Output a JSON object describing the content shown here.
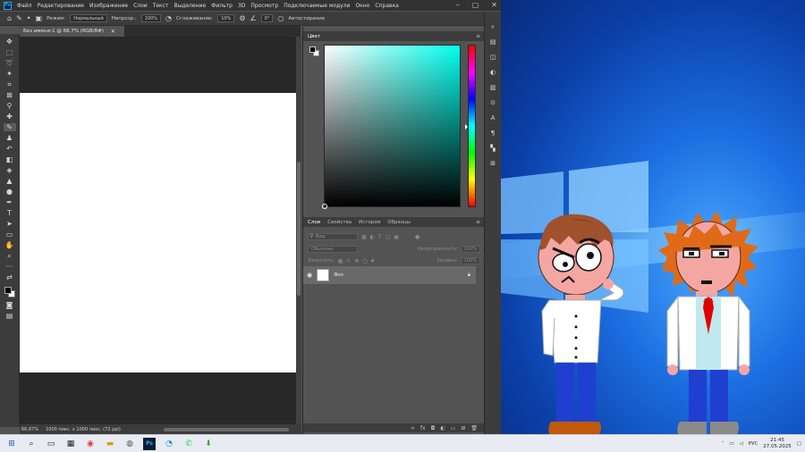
{
  "menubar": {
    "logo": "Ps",
    "items": [
      "Файл",
      "Редактирование",
      "Изображение",
      "Слои",
      "Текст",
      "Выделение",
      "Фильтр",
      "3D",
      "Просмотр",
      "Подключаемые модули",
      "Окно",
      "Справка"
    ]
  },
  "options": {
    "mode_label": "Режим:",
    "mode_value": "Нормальный",
    "opacity_label": "Непрозр.:",
    "opacity_value": "100%",
    "smoothing_label": "Сглаживание:",
    "smoothing_value": "10%",
    "angle_value": "0°",
    "autoerase_label": "Автостирание"
  },
  "document": {
    "tab_title": "Без имени-1 @ 66,7% (RGB/8#)",
    "zoom": "66,67%",
    "info": "1000 пикс. x 1000 пикс. (72 ppi)"
  },
  "color_panel": {
    "title": "Цвет",
    "foreground": "#000000",
    "background": "#ffffff",
    "hue_color": "#00ffee"
  },
  "layers_panel": {
    "tabs": [
      "Слои",
      "Свойства",
      "История",
      "Образцы"
    ],
    "search_placeholder": "Вид",
    "blend_mode": "Обычные",
    "opacity_label": "Непрозрачность:",
    "opacity_value": "100%",
    "lock_label": "Закрепить:",
    "fill_label": "Заливка:",
    "fill_value": "100%",
    "layer_name": "Фон"
  },
  "taskbar": {
    "language": "РУС",
    "time": "21:45",
    "date": "27.05.2025"
  }
}
